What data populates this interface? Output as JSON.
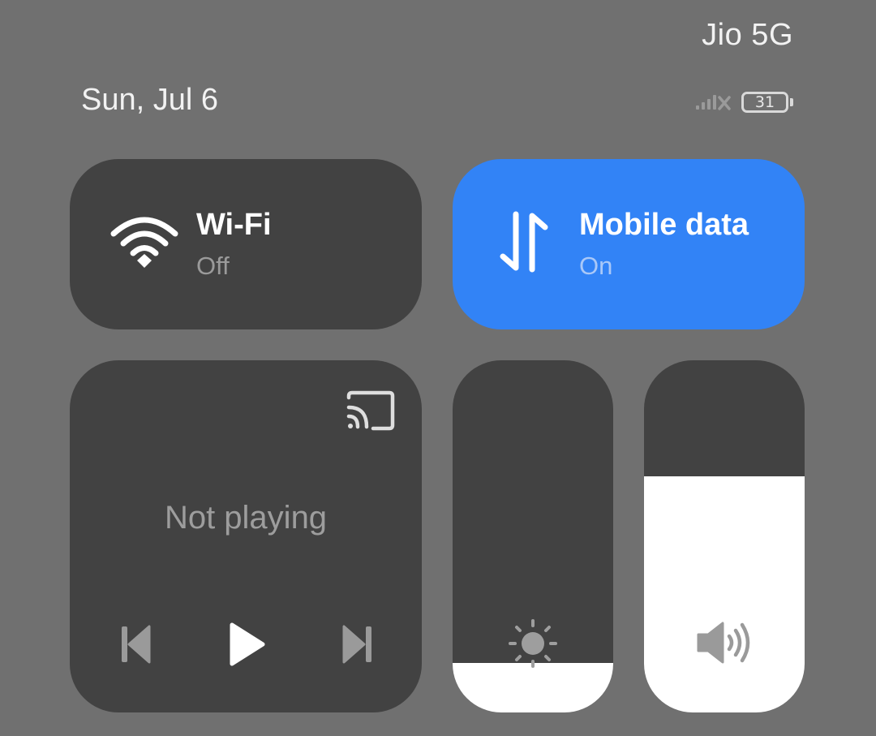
{
  "status_bar": {
    "carrier": "Jio 5G",
    "date": "Sun, Jul 6",
    "battery_level": "31",
    "icons": [
      "signal-off-icon",
      "battery-icon"
    ]
  },
  "tiles": {
    "wifi": {
      "title": "Wi-Fi",
      "status": "Off",
      "icon": "wifi-icon",
      "active": false
    },
    "mobile_data": {
      "title": "Mobile data",
      "status": "On",
      "icon": "data-arrows-icon",
      "active": true
    }
  },
  "media": {
    "status": "Not playing",
    "icons": [
      "cast-icon",
      "previous-icon",
      "play-icon",
      "next-icon"
    ]
  },
  "sliders": {
    "brightness": {
      "icon": "brightness-icon",
      "level": 0.14
    },
    "volume": {
      "icon": "volume-icon",
      "level": 0.67
    }
  },
  "colors": {
    "background": "#707070",
    "tile": "#424242",
    "accent": "#3283f6",
    "fill": "#ffffff"
  }
}
